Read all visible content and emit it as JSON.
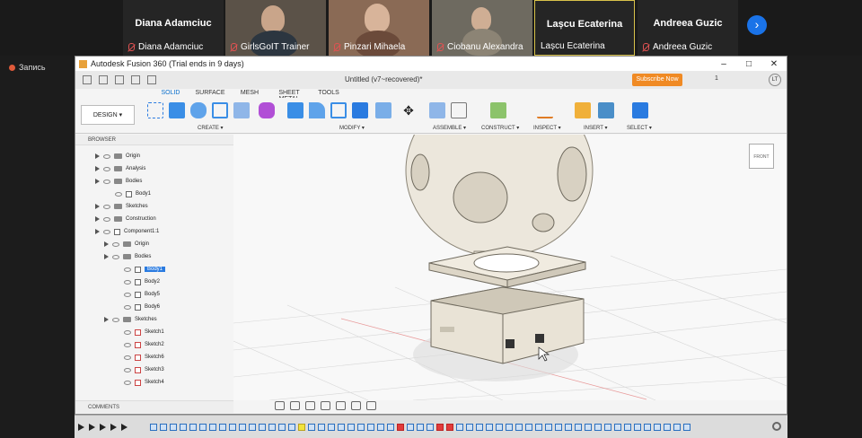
{
  "participants": [
    {
      "tile_name": "Diana Adamciuc",
      "caption": "Diana Adamciuc"
    },
    {
      "tile_name": "",
      "caption": "GirlsGoIT Trainer"
    },
    {
      "tile_name": "",
      "caption": "Pinzari Mihaela"
    },
    {
      "tile_name": "",
      "caption": "Ciobanu Alexandra"
    },
    {
      "tile_name": "Lașcu Ecaterina",
      "caption": "Lașcu Ecaterina"
    },
    {
      "tile_name": "Andreea Guzic",
      "caption": "Andreea Guzic"
    }
  ],
  "recording_label": "Запись",
  "window": {
    "title": "Autodesk Fusion 360 (Trial ends in 9 days)",
    "document": "Untitled (v7~recovered)*",
    "subscribe": "Subscribe Now",
    "user_initials": "LT",
    "jobs_count": "1"
  },
  "tabs": [
    "SOLID",
    "SURFACE",
    "MESH",
    "SHEET METAL",
    "TOOLS"
  ],
  "workspace_button": "DESIGN ▾",
  "tool_groups": [
    "CREATE ▾",
    "MODIFY ▾",
    "ASSEMBLE ▾",
    "CONSTRUCT ▾",
    "INSPECT ▾",
    "INSERT ▾",
    "SELECT ▾"
  ],
  "browser": {
    "header": "BROWSER",
    "items": [
      "Origin",
      "Analysis",
      "Bodies",
      "Body1",
      "Sketches",
      "Construction",
      "Component1:1",
      "Origin",
      "Bodies",
      "Body1",
      "Body2",
      "Body5",
      "Body6",
      "Sketches",
      "Sketch1",
      "Sketch2",
      "Sketch6",
      "Sketch3",
      "Sketch4"
    ]
  },
  "comments_label": "COMMENTS",
  "colors": {
    "accent": "#0a6fcc",
    "subscribe": "#f08a24",
    "selection": "#2a7be0"
  }
}
